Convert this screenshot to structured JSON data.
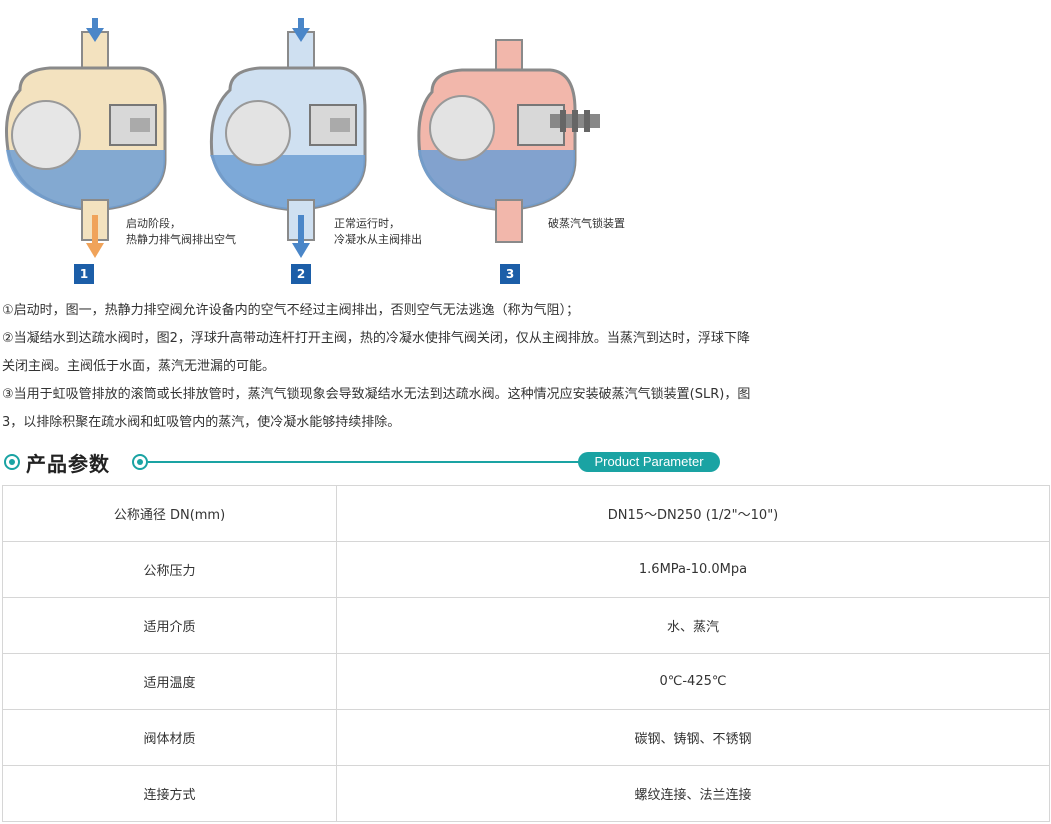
{
  "diagrams": [
    {
      "step": "1",
      "caption_line1": "启动阶段，",
      "caption_line2": "热静力排气阀排出空气",
      "body_color": "#f3e2bf",
      "water_color": "#6f9fd3"
    },
    {
      "step": "2",
      "caption_line1": "正常运行时，",
      "caption_line2": "冷凝水从主阀排出",
      "body_color": "#cfe0f1",
      "water_color": "#6f9fd3"
    },
    {
      "step": "3",
      "caption_line1": "破蒸汽气锁装置",
      "caption_line2": "",
      "body_color": "#f2b7ab",
      "water_color": "#6f9fd3"
    }
  ],
  "description": {
    "p1": "①启动时，图一，热静力排空阀允许设备内的空气不经过主阀排出，否则空气无法逃逸（称为气阻）；",
    "p2a": "②当凝结水到达疏水阀时，图2，浮球升高带动连杆打开主阀，热的冷凝水使排气阀关闭，仅从主阀排放。当蒸汽到达时，浮球下降",
    "p2b": "关闭主阀。主阀低于水面，蒸汽无泄漏的可能。",
    "p3a": "③当用于虹吸管排放的滚筒或长排放管时，蒸汽气锁现象会导致凝结水无法到达疏水阀。这种情况应安装破蒸汽气锁装置(SLR)，图",
    "p3b": "3，以排除积聚在疏水阀和虹吸管内的蒸汽，使冷凝水能够持续排除。"
  },
  "section": {
    "title": "产品参数",
    "badge": "Product Parameter",
    "accent": "#1aa3a3"
  },
  "params": [
    {
      "name": "公称通径 DN(mm)",
      "value": "DN15～DN250 (1/2\"～10\")"
    },
    {
      "name": "公称压力",
      "value": "1.6MPa-10.0Mpa"
    },
    {
      "name": "适用介质",
      "value": "水、蒸汽"
    },
    {
      "name": "适用温度",
      "value": "0℃-425℃"
    },
    {
      "name": "阀体材质",
      "value": "碳钢、铸钢、不锈钢"
    },
    {
      "name": "连接方式",
      "value": "螺纹连接、法兰连接"
    }
  ]
}
